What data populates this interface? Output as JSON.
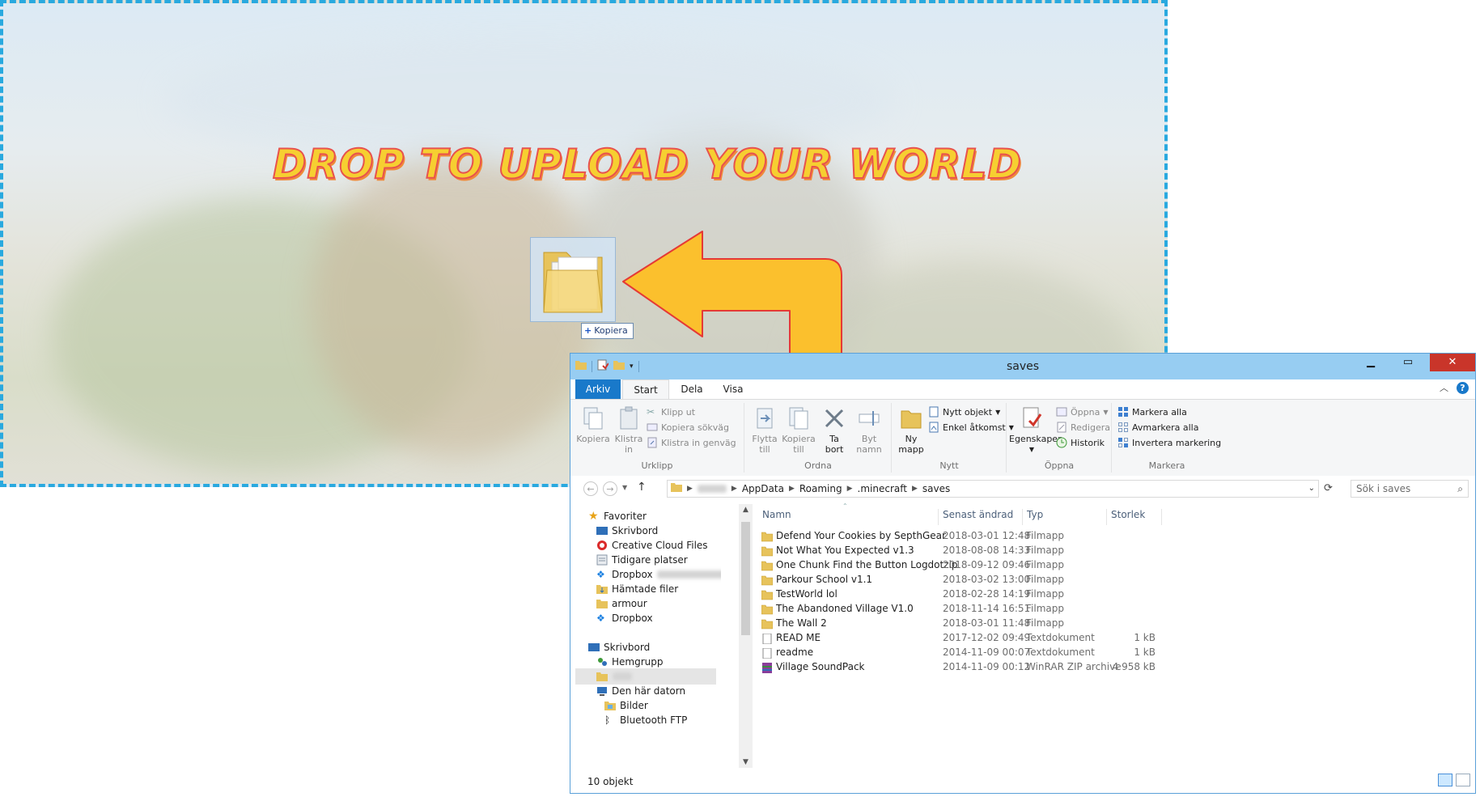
{
  "dropzone": {
    "title": "DROP TO UPLOAD YOUR WORLD",
    "drag_tooltip": "Kopiera"
  },
  "window": {
    "title": "saves",
    "tabs": [
      "Arkiv",
      "Start",
      "Dela",
      "Visa"
    ],
    "ribbon": {
      "urklipp": {
        "label": "Urklipp",
        "kopiera": "Kopiera",
        "klistra_in_l1": "Klistra",
        "klistra_in_l2": "in",
        "klipp_ut": "Klipp ut",
        "kopiera_sokvag": "Kopiera sökväg",
        "klistra_genvag": "Klistra in genväg"
      },
      "ordna": {
        "label": "Ordna",
        "flytta_l1": "Flytta",
        "flytta_l2": "till",
        "kopiera_l1": "Kopiera",
        "kopiera_l2": "till",
        "ta_bort_l1": "Ta",
        "ta_bort_l2": "bort",
        "byt_namn_l1": "Byt",
        "byt_namn_l2": "namn"
      },
      "nytt": {
        "label": "Nytt",
        "ny_mapp_l1": "Ny",
        "ny_mapp_l2": "mapp",
        "nytt_objekt": "Nytt objekt",
        "enkel_atkomst": "Enkel åtkomst"
      },
      "oppna": {
        "label": "Öppna",
        "egenskaper": "Egenskaper",
        "oppna": "Öppna",
        "redigera": "Redigera",
        "historik": "Historik"
      },
      "markera": {
        "label": "Markera",
        "markera_alla": "Markera alla",
        "avmarkera_alla": "Avmarkera alla",
        "invertera": "Invertera markering"
      }
    },
    "address": {
      "crumbs": [
        "AppData",
        "Roaming",
        ".minecraft",
        "saves"
      ],
      "search_placeholder": "Sök i saves"
    },
    "nav": {
      "favorites_header": "Favoriter",
      "favorites": [
        "Skrivbord",
        "Creative Cloud Files",
        "Tidigare platser",
        "Dropbox",
        "Hämtade filer",
        "armour",
        "Dropbox"
      ],
      "desktop_header": "Skrivbord",
      "hemgrupp": "Hemgrupp",
      "this_pc": "Den här datorn",
      "this_pc_children": [
        "Bilder",
        "Bluetooth FTP"
      ]
    },
    "columns": {
      "name": "Namn",
      "date": "Senast ändrad",
      "type": "Typ",
      "size": "Storlek"
    },
    "files": [
      {
        "name": "Defend Your Cookies by SepthGear",
        "date": "2018-03-01 12:48",
        "type": "Filmapp",
        "size": "",
        "kind": "folder"
      },
      {
        "name": "Not What You Expected v1.3",
        "date": "2018-08-08 14:33",
        "type": "Filmapp",
        "size": "",
        "kind": "folder"
      },
      {
        "name": "One Chunk Find the Button Logdotzip",
        "date": "2018-09-12 09:46",
        "type": "Filmapp",
        "size": "",
        "kind": "folder"
      },
      {
        "name": "Parkour School v1.1",
        "date": "2018-03-02 13:00",
        "type": "Filmapp",
        "size": "",
        "kind": "folder"
      },
      {
        "name": "TestWorld lol",
        "date": "2018-02-28 14:19",
        "type": "Filmapp",
        "size": "",
        "kind": "folder"
      },
      {
        "name": "The Abandoned Village V1.0",
        "date": "2018-11-14 16:51",
        "type": "Filmapp",
        "size": "",
        "kind": "folder"
      },
      {
        "name": "The Wall 2",
        "date": "2018-03-01 11:48",
        "type": "Filmapp",
        "size": "",
        "kind": "folder"
      },
      {
        "name": "READ ME",
        "date": "2017-12-02 09:49",
        "type": "Textdokument",
        "size": "1 kB",
        "kind": "text"
      },
      {
        "name": "readme",
        "date": "2014-11-09 00:07",
        "type": "Textdokument",
        "size": "1 kB",
        "kind": "text"
      },
      {
        "name": "Village SoundPack",
        "date": "2014-11-09 00:12",
        "type": "WinRAR ZIP archive",
        "size": "4 958 kB",
        "kind": "zip"
      }
    ],
    "status": "10 objekt"
  },
  "colors": {
    "accent": "#1979ca",
    "title_bar": "#97cdf2",
    "drop_border": "#29a9df",
    "arrow_fill": "#fbc02d",
    "arrow_stroke": "#e53935"
  }
}
